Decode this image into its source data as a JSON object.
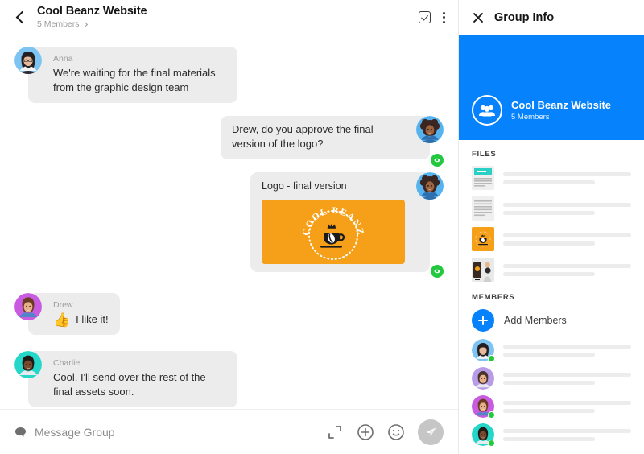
{
  "window": {
    "chat_header": {
      "back_icon": "back-arrow-icon",
      "title": "Cool Beanz Website",
      "subtitle": "5 Members",
      "chevron_icon": "chevron-right-icon",
      "select_icon": "checkbox-square-icon",
      "menu_icon": "more-vertical-icon"
    },
    "messages": [
      {
        "id": "msg-anna",
        "direction": "in",
        "sender": "Anna",
        "avatar_name": "avatar-anna",
        "avatar_bg": "#7EC4F2",
        "text": "We're waiting for the final materials from the graphic design team",
        "seen": false
      },
      {
        "id": "msg-approve",
        "direction": "out",
        "sender": "",
        "avatar_name": "avatar-self",
        "avatar_bg": "#56B3EE",
        "text": "Drew, do you approve the final version of the logo?",
        "seen": true,
        "seen_icon": "eye-seen-icon"
      },
      {
        "id": "msg-logo",
        "direction": "out",
        "sender": "",
        "avatar_name": "avatar-self",
        "avatar_bg": "#56B3EE",
        "caption": "Logo - final version",
        "attachment": {
          "name": "cool-beanz-logo",
          "bg": "#F6A01A",
          "arc_text": "COOL BEANZ",
          "icons": [
            "crown-icon",
            "coffee-cup-icon",
            "coffee-bean-icon"
          ]
        },
        "seen": true,
        "seen_icon": "eye-seen-icon"
      },
      {
        "id": "msg-drew",
        "direction": "in",
        "sender": "Drew",
        "avatar_name": "avatar-drew",
        "avatar_bg": "#C85BE0",
        "emoji": "👍",
        "emoji_name": "thumbs-up-emoji",
        "text": "I like it!",
        "seen": false
      },
      {
        "id": "msg-charlie",
        "direction": "in",
        "sender": "Charlie",
        "avatar_name": "avatar-charlie",
        "avatar_bg": "#24D7C8",
        "text": "Cool. I'll send over the rest of the final assets soon.",
        "seen": false
      }
    ],
    "composer": {
      "bubble_icon": "chat-bubble-icon",
      "placeholder": "Message Group",
      "value": "",
      "expand_icon": "expand-icon",
      "plus_icon": "plus-circle-icon",
      "emoji_icon": "smiley-icon",
      "send_icon": "send-paper-plane-icon"
    }
  },
  "info_panel": {
    "close_icon": "close-icon",
    "title": "Group Info",
    "banner": {
      "color": "#0582FC",
      "group_icon": "group-people-icon",
      "name": "Cool Beanz Website",
      "members": "5 Members"
    },
    "files_label": "FILES",
    "files": [
      {
        "thumb": "document-teal-header-thumb"
      },
      {
        "thumb": "document-plain-thumb"
      },
      {
        "thumb": "cool-beanz-logo-thumb"
      },
      {
        "thumb": "photo-coffee-thumb"
      }
    ],
    "members_label": "MEMBERS",
    "add_members": {
      "icon": "plus-circle-icon",
      "label": "Add Members"
    },
    "members": [
      {
        "avatar_name": "avatar-anna",
        "avatar_bg": "#7EC4F2",
        "online": true
      },
      {
        "avatar_name": "avatar-member2",
        "avatar_bg": "#B89CE8",
        "online": false
      },
      {
        "avatar_name": "avatar-drew",
        "avatar_bg": "#C85BE0",
        "online": true
      },
      {
        "avatar_name": "avatar-charlie",
        "avatar_bg": "#24D7C8",
        "online": true
      }
    ]
  }
}
